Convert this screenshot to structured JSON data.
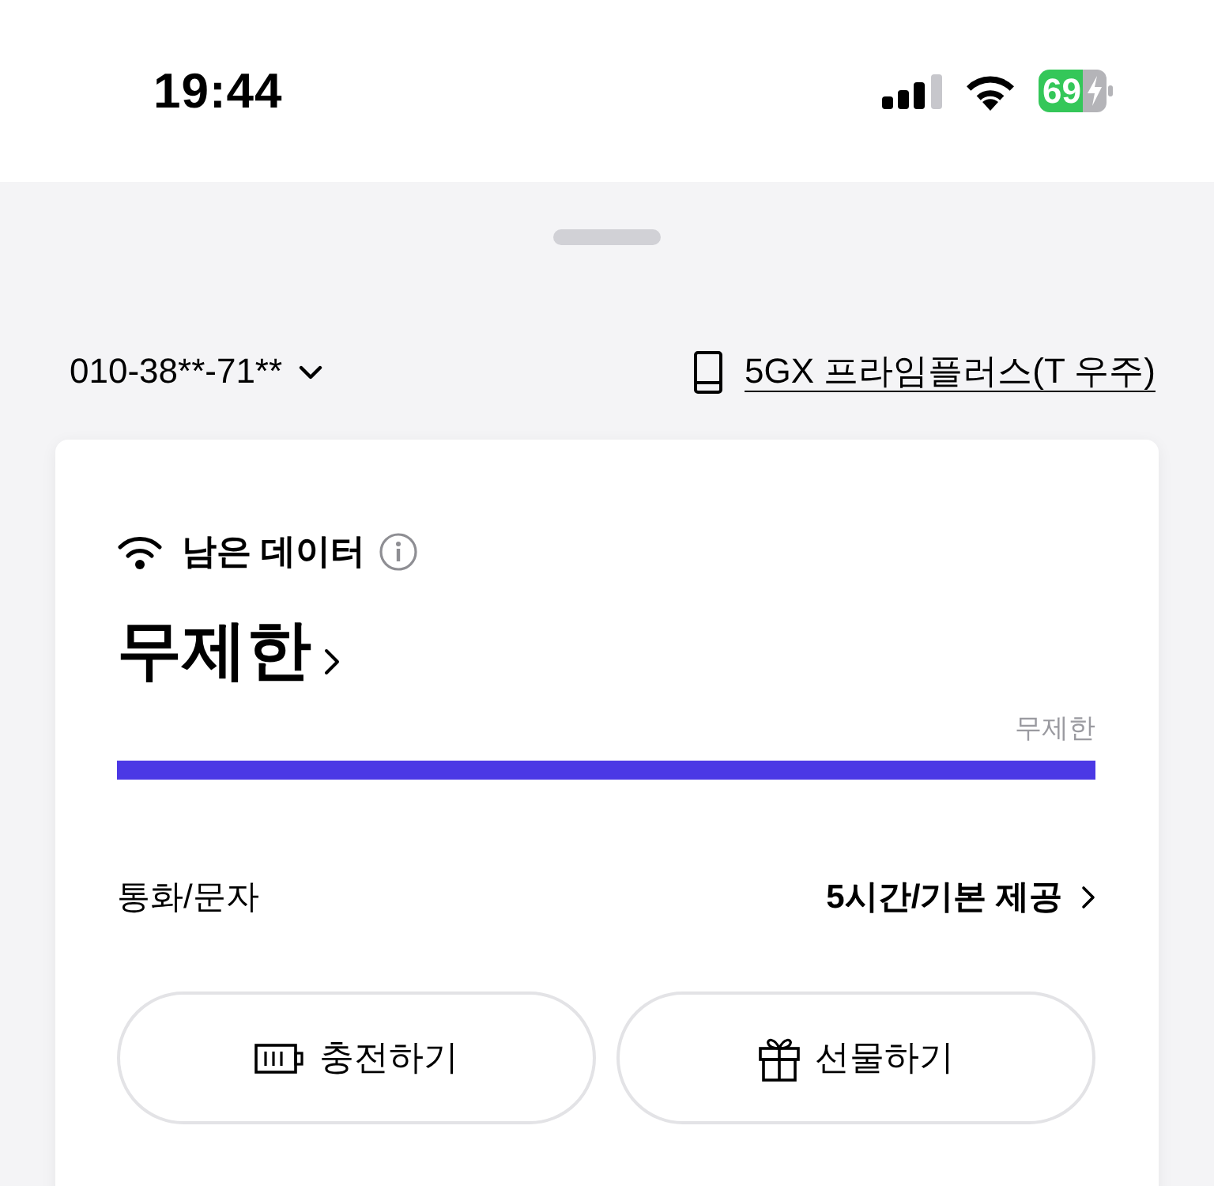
{
  "status_bar": {
    "time": "19:44",
    "battery": "69"
  },
  "header": {
    "phone_number": "010-38**-71**",
    "plan": "5GX 프라임플러스(T 우주)"
  },
  "data_card": {
    "title": "남은 데이터",
    "value": "무제한",
    "meter": {
      "label": "무제한",
      "level": 1
    }
  },
  "call_text": {
    "label": "통화/문자",
    "value": "5시간/기본 제공"
  },
  "buttons": [
    {
      "kind": "charge",
      "label": "충전하기"
    },
    {
      "kind": "gift",
      "label": "선물하기"
    }
  ]
}
